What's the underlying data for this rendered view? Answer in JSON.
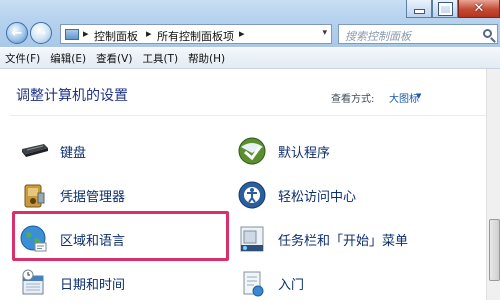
{
  "window": {
    "minimize_label": "minimize",
    "maximize_label": "maximize",
    "close_label": "close"
  },
  "address": {
    "crumbs": [
      "控制面板",
      "所有控制面板项"
    ]
  },
  "search": {
    "placeholder": "搜索控制面板"
  },
  "menu": [
    "文件(F)",
    "编辑(E)",
    "查看(V)",
    "工具(T)",
    "帮助(H)"
  ],
  "main": {
    "title": "调整计算机的设置",
    "view_by_label": "查看方式:",
    "view_by_value": "大图标"
  },
  "items": [
    {
      "label": "键盘",
      "icon": "keyboard-icon"
    },
    {
      "label": "默认程序",
      "icon": "default-programs-icon"
    },
    {
      "label": "凭据管理器",
      "icon": "credential-manager-icon"
    },
    {
      "label": "轻松访问中心",
      "icon": "ease-of-access-icon"
    },
    {
      "label": "区域和语言",
      "icon": "region-language-icon"
    },
    {
      "label": "任务栏和「开始」菜单",
      "icon": "taskbar-start-icon"
    },
    {
      "label": "日期和时间",
      "icon": "date-time-icon"
    },
    {
      "label": "入门",
      "icon": "getting-started-icon"
    }
  ],
  "highlight_color": "#d9306a"
}
